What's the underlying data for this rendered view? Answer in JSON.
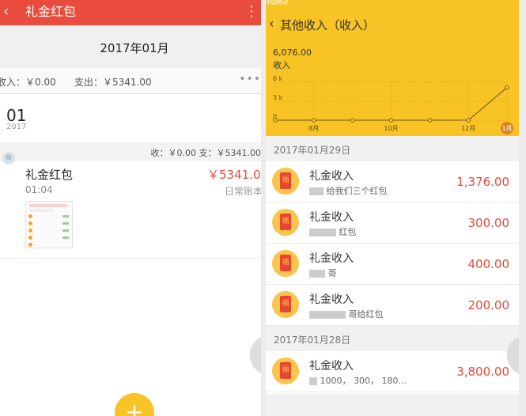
{
  "left": {
    "header": {
      "back_icon": "‹",
      "title": "礼金红包",
      "more_icon": "⋮"
    },
    "month": "2017年01月",
    "summary": {
      "income": "收入：￥0.00",
      "expense": "支出：￥5341.00",
      "more": "•••"
    },
    "day": {
      "number": "01",
      "year": "2017"
    },
    "day_total": "收：￥0.00 支：￥5341.00",
    "entry": {
      "title": "礼金红包",
      "amount": "￥5341.00",
      "time": "01:04",
      "account": "日常账本"
    },
    "fab_icon": "+"
  },
  "right": {
    "status_bar": "中国移动",
    "header": {
      "back_icon": "‹",
      "title": "其他收入（收入）"
    },
    "chart_data": {
      "type": "line",
      "title": "",
      "total_text": "6,076.00",
      "series_label": "收入",
      "x_tick_labels": [
        "8月",
        "10月",
        "12月",
        "1月"
      ],
      "y_tick_labels": [
        "6 k",
        "3 k",
        "0"
      ],
      "ylim": [
        0,
        6000
      ],
      "x": [
        "7月",
        "8月",
        "9月",
        "10月",
        "11月",
        "12月",
        "1月"
      ],
      "values": [
        0,
        0,
        0,
        0,
        0,
        0,
        5176
      ],
      "selected": "1月",
      "colors": {
        "line": "#8a6a1f",
        "grid": "#d9a91b",
        "selected": "#d9831f"
      }
    },
    "groups": [
      {
        "date": "2017年01月29日",
        "items": [
          {
            "title": "礼金收入",
            "note": "给我们三个红包",
            "amount": "1,376.00"
          },
          {
            "title": "礼金收入",
            "note": "红包",
            "amount": "300.00"
          },
          {
            "title": "礼金收入",
            "note": "哥",
            "amount": "400.00"
          },
          {
            "title": "礼金收入",
            "note": "哥给红包",
            "amount": "200.00"
          }
        ]
      },
      {
        "date": "2017年01月28日",
        "items": [
          {
            "title": "礼金收入",
            "note": "1000，       300，      180…",
            "amount": "3,800.00"
          }
        ]
      }
    ],
    "icon_glyph": "福"
  },
  "colors": {
    "red_bar": "#e94b3c",
    "yellow": "#f7c325",
    "amount_red": "#e94b3c"
  }
}
